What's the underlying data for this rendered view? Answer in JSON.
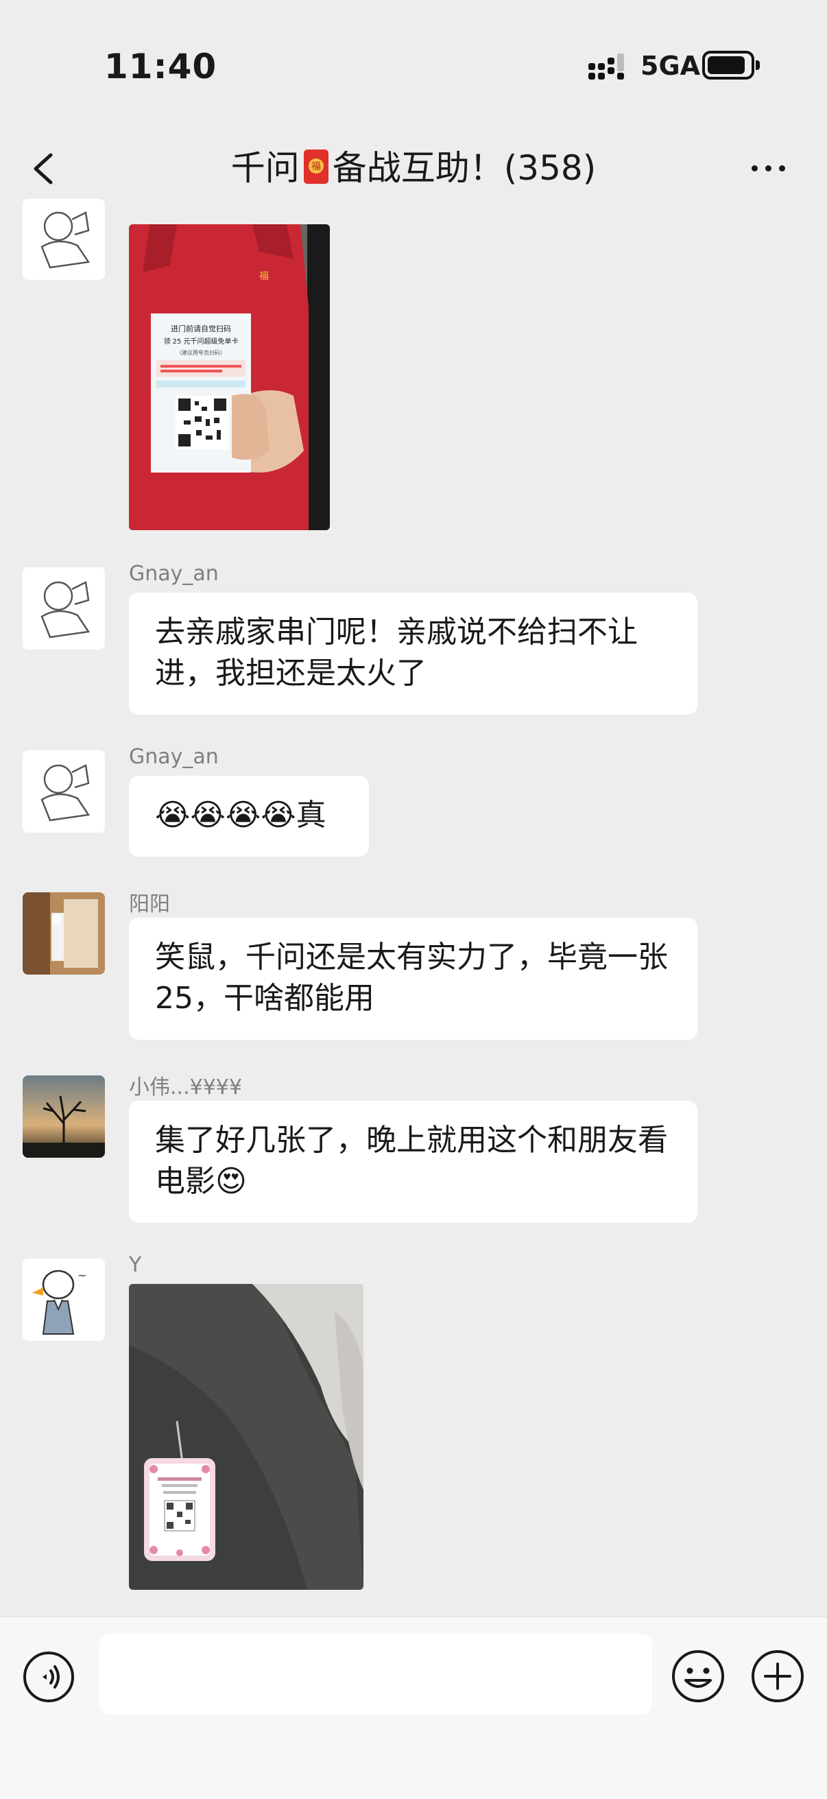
{
  "status_bar": {
    "time": "11:40",
    "network": "5GA"
  },
  "nav": {
    "title_before": "千问",
    "title_after": "备战互助！(358)"
  },
  "messages": [
    {
      "type": "image",
      "sender": "",
      "photo_text": {
        "line1": "进门前请自觉扫码",
        "line2": "领 25 元千问超级免单卡",
        "line3": "（建议用夸克扫码）"
      }
    },
    {
      "type": "text",
      "sender": "Gnay_an",
      "text": "去亲戚家串门呢！亲戚说不给扫不让进，我担还是太火了"
    },
    {
      "type": "text",
      "sender": "Gnay_an",
      "text": "😭😭😭😭真"
    },
    {
      "type": "text",
      "sender": "阳阳",
      "text": "笑鼠，千问还是太有实力了，毕竟一张25，干啥都能用"
    },
    {
      "type": "text",
      "sender": "小伟...¥¥¥¥",
      "text": "集了好几张了，晚上就用这个和朋友看电影😍"
    },
    {
      "type": "image",
      "sender": "Y"
    }
  ],
  "icons": {
    "back": "chevron-left-icon",
    "more": "more-dots-icon",
    "voice": "voice-icon",
    "emoji": "emoji-icon",
    "plus": "plus-icon"
  },
  "colors": {
    "background": "#ededed",
    "bubble": "#ffffff",
    "text": "#191919",
    "meta": "#7f7f7f"
  }
}
